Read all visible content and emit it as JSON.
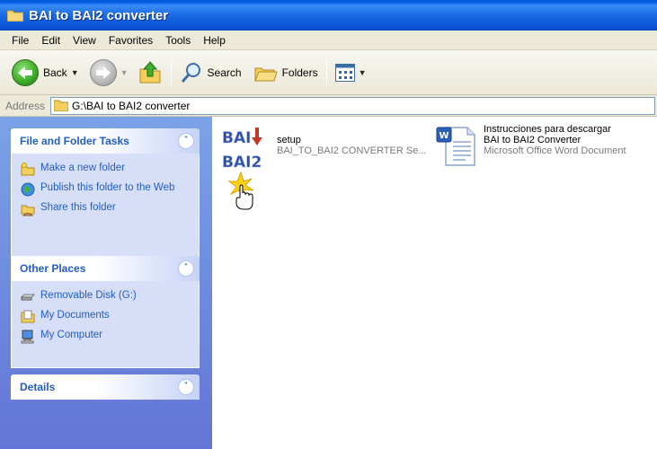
{
  "window": {
    "title": "BAI to BAI2 converter"
  },
  "menu": [
    "File",
    "Edit",
    "View",
    "Favorites",
    "Tools",
    "Help"
  ],
  "toolbar": {
    "back_label": "Back",
    "search_label": "Search",
    "folders_label": "Folders"
  },
  "address": {
    "label": "Address",
    "value": "G:\\BAI to BAI2 converter"
  },
  "taskpane": {
    "file_folder_tasks": {
      "title": "File and Folder Tasks",
      "items": [
        "Make a new folder",
        "Publish this folder to the Web",
        "Share this folder"
      ]
    },
    "other_places": {
      "title": "Other Places",
      "items": [
        "Removable Disk (G:)",
        "My Documents",
        "My Computer"
      ]
    },
    "details": {
      "title": "Details"
    }
  },
  "files": [
    {
      "name": "setup",
      "description": "BAI_TO_BAI2 CONVERTER Se...",
      "icon_top": "BAI",
      "icon_bottom": "BAI2"
    },
    {
      "name_lines": [
        "Instrucciones para descargar",
        "BAI to BAI2 Converter"
      ],
      "description": "Microsoft Office Word Document",
      "icon": "word-document-icon"
    }
  ],
  "colors": {
    "title_bar": "#0a56d8",
    "task_pane": "#6f8fe0",
    "link": "#215dc6"
  }
}
